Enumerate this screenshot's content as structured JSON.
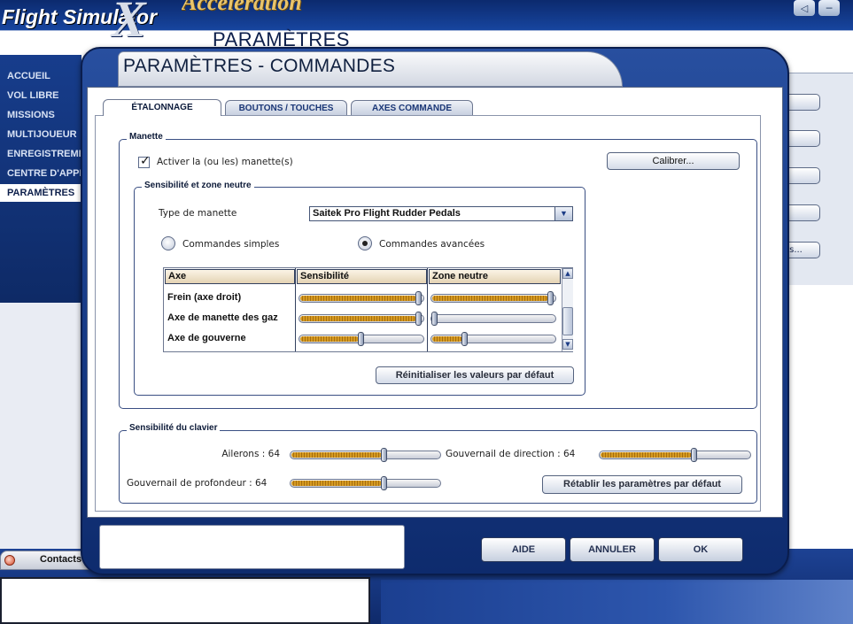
{
  "app": {
    "brand": "Flight Simulator",
    "brand_x": "X",
    "expansion": "Acceleration",
    "page_title": "PARAMÈTRES"
  },
  "window_controls": [
    {
      "name": "sound-icon",
      "glyph": "◁"
    },
    {
      "name": "minimize-icon",
      "glyph": "─"
    }
  ],
  "sidebar": {
    "items": [
      {
        "label": "ACCUEIL",
        "active": false
      },
      {
        "label": "VOL LIBRE",
        "active": false
      },
      {
        "label": "MISSIONS",
        "active": false
      },
      {
        "label": "MULTIJOUEUR",
        "active": false
      },
      {
        "label": "ENREGISTREMENT",
        "active": false
      },
      {
        "label": "CENTRE D'APPRENTISSAGE",
        "active": false
      },
      {
        "label": "PARAMÈTRES",
        "active": true
      }
    ]
  },
  "right_strip": {
    "buttons": [
      "",
      "",
      "",
      "",
      "rs..."
    ]
  },
  "contacts": {
    "label": "Contacts"
  },
  "dialog": {
    "title": "PARAMÈTRES - COMMANDES",
    "tabs": [
      {
        "label": "ÉTALONNAGE",
        "active": true
      },
      {
        "label": "BOUTONS / TOUCHES",
        "active": false
      },
      {
        "label": "AXES COMMANDE",
        "active": false
      }
    ],
    "manette": {
      "group_label": "Manette",
      "enable_checkbox": {
        "label": "Activer la (ou les) manette(s)",
        "checked": true
      },
      "calibrate_button": "Calibrer...",
      "sensitivity_group": {
        "group_label": "Sensibilité et zone neutre",
        "type_label": "Type de manette",
        "type_value": "Saitek Pro Flight Rudder Pedals",
        "radio_simple": {
          "label": "Commandes simples",
          "selected": false
        },
        "radio_advanced": {
          "label": "Commandes avancées",
          "selected": true
        },
        "table": {
          "headers": [
            "Axe",
            "Sensibilité",
            "Zone neutre"
          ],
          "rows": [
            {
              "axe": "Frein (axe droit)",
              "sensibilite": 1.0,
              "zone_neutre": 1.0
            },
            {
              "axe": "Axe de manette des gaz",
              "sensibilite": 1.0,
              "zone_neutre": 0.0
            },
            {
              "axe": "Axe de gouverne",
              "sensibilite": 0.5,
              "zone_neutre": 0.26
            }
          ]
        },
        "reset_button": "Réinitialiser les valeurs par défaut"
      }
    },
    "keyboard": {
      "group_label": "Sensibilité du clavier",
      "ailerons_label": "Ailerons : 64",
      "ailerons_value": 0.64,
      "direction_label": "Gouvernail de direction : 64",
      "direction_value": 0.64,
      "profondeur_label": "Gouvernail de profondeur : 64",
      "profondeur_value": 0.64,
      "restore_button": "Rétablir les paramètres par défaut"
    },
    "footer": {
      "help_button": "AIDE",
      "cancel_button": "ANNULER",
      "ok_button": "OK"
    }
  }
}
